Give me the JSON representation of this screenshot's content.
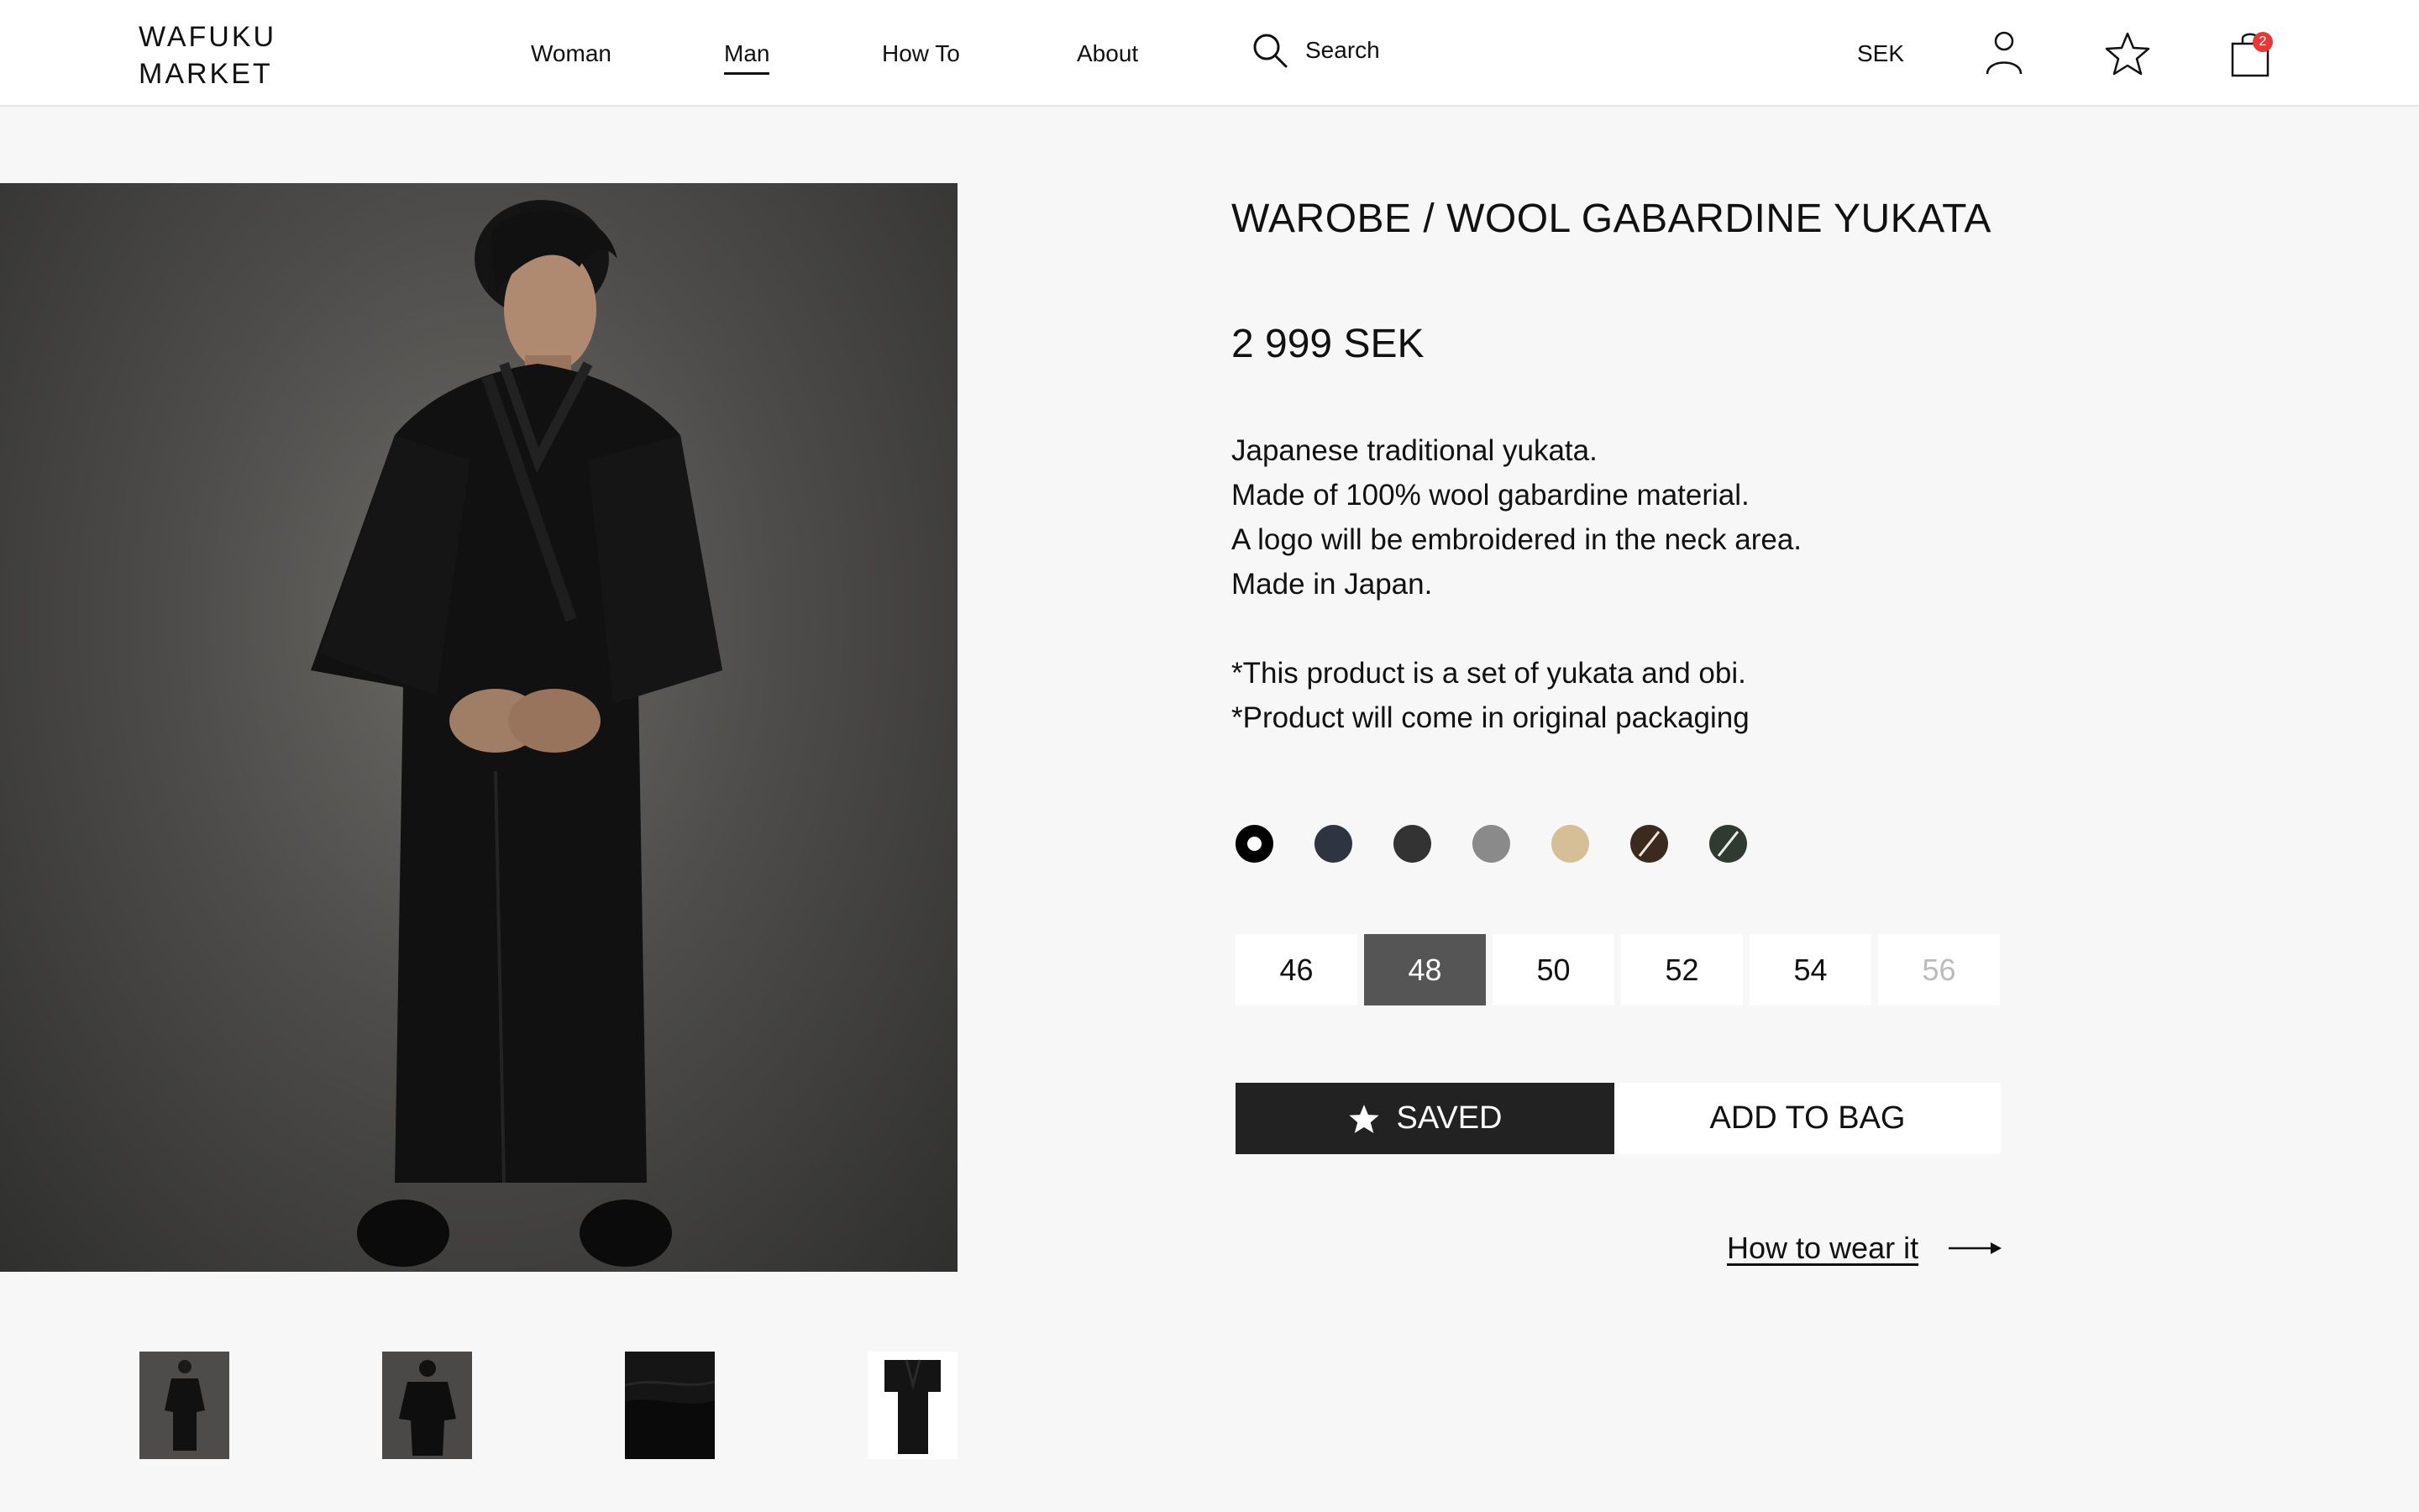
{
  "header": {
    "logo_line1": "WAFUKU",
    "logo_line2": "MARKET",
    "nav": {
      "woman": "Woman",
      "man": "Man",
      "how_to": "How To",
      "about": "About"
    },
    "search_label": "Search",
    "currency": "SEK",
    "cart_count": "2",
    "icons": [
      "search-icon",
      "user-icon",
      "star-icon",
      "shopping-bag-icon"
    ]
  },
  "gallery": {
    "main_photo": "man in black wool yukata",
    "thumbnails": [
      "front-view",
      "back-view",
      "fabric-closeup",
      "flat-lay"
    ]
  },
  "product": {
    "title": "WAROBE / WOOL GABARDINE YUKATA",
    "price": "2 999 SEK",
    "description": {
      "line1": "Japanese traditional yukata.",
      "line2": "Made of 100% wool gabardine material.",
      "line3": "A logo will be embroidered in the neck area.",
      "line4": "Made in Japan.",
      "note1": "*This product is a set of yukata and obi.",
      "note2": "*Product will come in original packaging"
    },
    "colors": [
      {
        "hex": "#000000",
        "selected": true
      },
      {
        "hex": "#2e3541",
        "selected": false
      },
      {
        "hex": "#333333",
        "selected": false
      },
      {
        "hex": "#8a8a8a",
        "selected": false
      },
      {
        "hex": "#d6bf97",
        "selected": false
      },
      {
        "hex": "#3a2a20",
        "selected": false,
        "crossed": true
      },
      {
        "hex": "#2f3a30",
        "selected": false,
        "crossed": true
      }
    ],
    "sizes": {
      "s46": "46",
      "s48": "48",
      "s50": "50",
      "s52": "52",
      "s54": "54",
      "s56": "56",
      "selected": "48",
      "unavailable": "56"
    },
    "saved_label": "SAVED",
    "add_to_bag_label": "ADD TO BAG",
    "how_to_wear_label": "How to wear it"
  },
  "colors": {
    "background": "#f7f7f7",
    "header_bg": "#ffffff",
    "saved_button_bg": "#222222",
    "selected_size_bg": "#555555",
    "badge": "#e53935"
  }
}
